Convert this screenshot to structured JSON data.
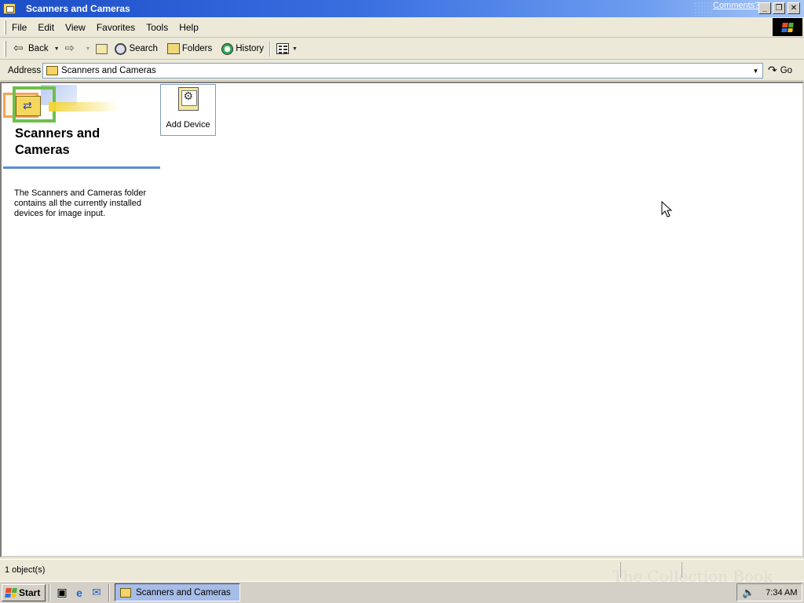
{
  "window": {
    "title": "Scanners and Cameras",
    "comments_link": "Comments?",
    "controls": {
      "minimize": "_",
      "maximize": "❐",
      "close": "✕"
    }
  },
  "menu": {
    "items": [
      "File",
      "Edit",
      "View",
      "Favorites",
      "Tools",
      "Help"
    ]
  },
  "toolbar": {
    "back": "Back",
    "search": "Search",
    "folders": "Folders",
    "history": "History"
  },
  "address": {
    "label": "Address",
    "value": "Scanners and Cameras",
    "go": "Go"
  },
  "sidepanel": {
    "heading": "Scanners and Cameras",
    "description": "The Scanners and Cameras folder contains all the currently installed devices for image input."
  },
  "items": [
    {
      "label": "Add Device",
      "icon": "add-device-icon"
    }
  ],
  "status": {
    "text": "1 object(s)"
  },
  "taskbar": {
    "start": "Start",
    "task": "Scanners and Cameras",
    "clock": "7:34 AM",
    "watermark": "The Collection Book"
  },
  "colors": {
    "titlebar": "#1c4ec7",
    "panel_divider": "#5b8ed6",
    "task_active": "#a7bde8"
  }
}
